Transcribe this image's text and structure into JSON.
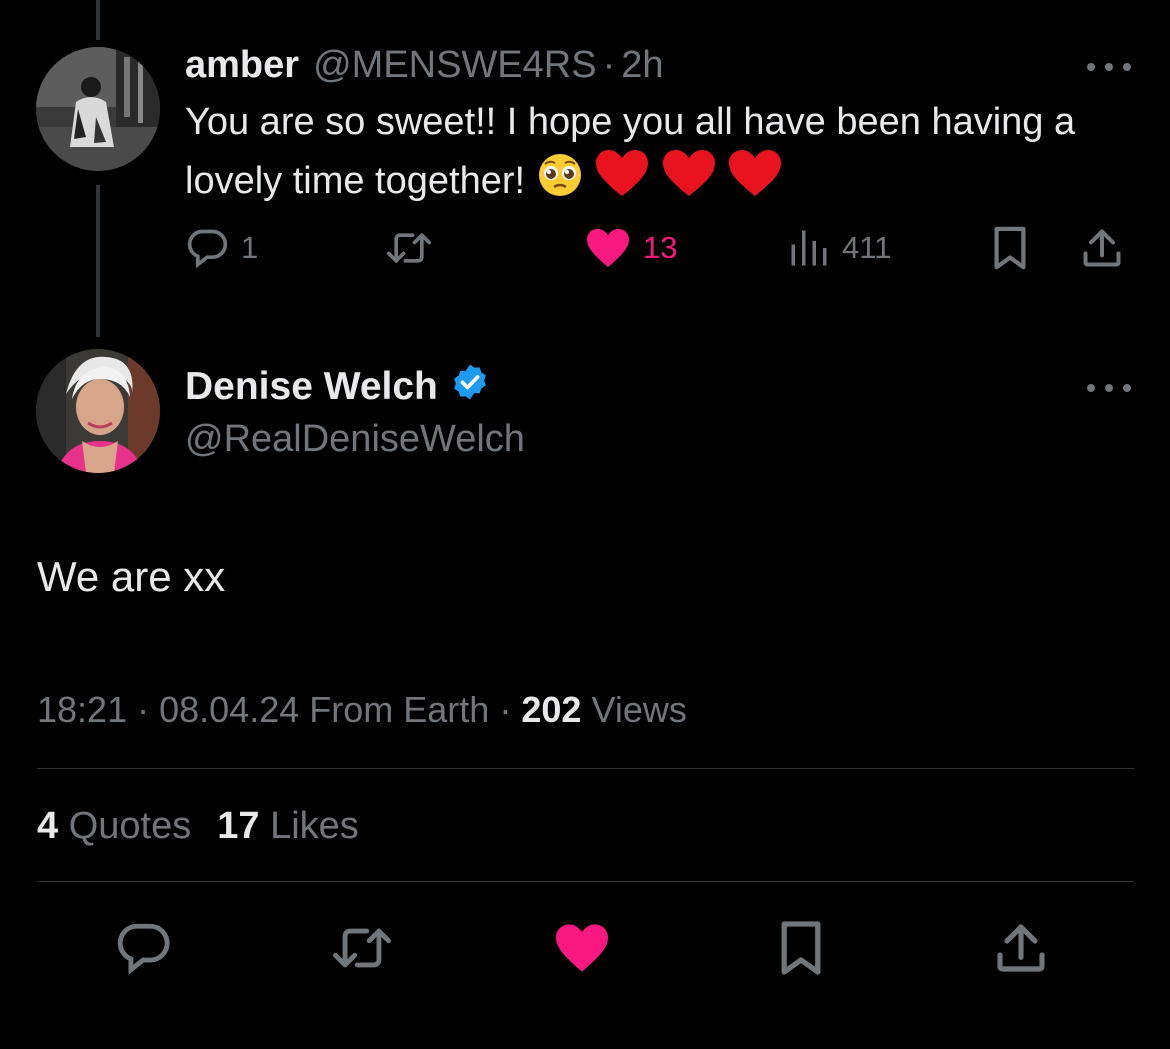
{
  "reply": {
    "name": "amber",
    "handle": "@MENSWE4RS",
    "separator": "·",
    "time": "2h",
    "text": "You are so sweet!! I hope you all have been having a lovely time together!",
    "emojis": [
      "pleading-face",
      "red-heart",
      "red-heart",
      "red-heart"
    ],
    "actions": {
      "replies": "1",
      "retweets": "",
      "likes": "13",
      "views": "411",
      "liked": true
    }
  },
  "tweet": {
    "name": "Denise Welch",
    "verified": true,
    "handle": "@RealDeniseWelch",
    "text": "We are xx",
    "time": "18:21",
    "date": "08.04.24",
    "source": "From Earth",
    "separator": "·",
    "views_count": "202",
    "views_label": "Views",
    "quotes_count": "4",
    "quotes_label": "Quotes",
    "likes_count": "17",
    "likes_label": "Likes",
    "liked": true
  },
  "colors": {
    "background": "#000000",
    "text": "#e7e9ea",
    "muted": "#71767b",
    "like": "#f91880",
    "verified": "#1d9bf0",
    "divider": "#2f3336"
  },
  "icons": {
    "reply_actions": [
      "reply-icon",
      "retweet-icon",
      "heart-icon",
      "views-icon",
      "bookmark-icon",
      "share-icon"
    ],
    "bottom_bar": [
      "reply-icon",
      "retweet-icon",
      "heart-icon",
      "bookmark-icon",
      "share-icon"
    ],
    "overflow": "more-icon"
  }
}
